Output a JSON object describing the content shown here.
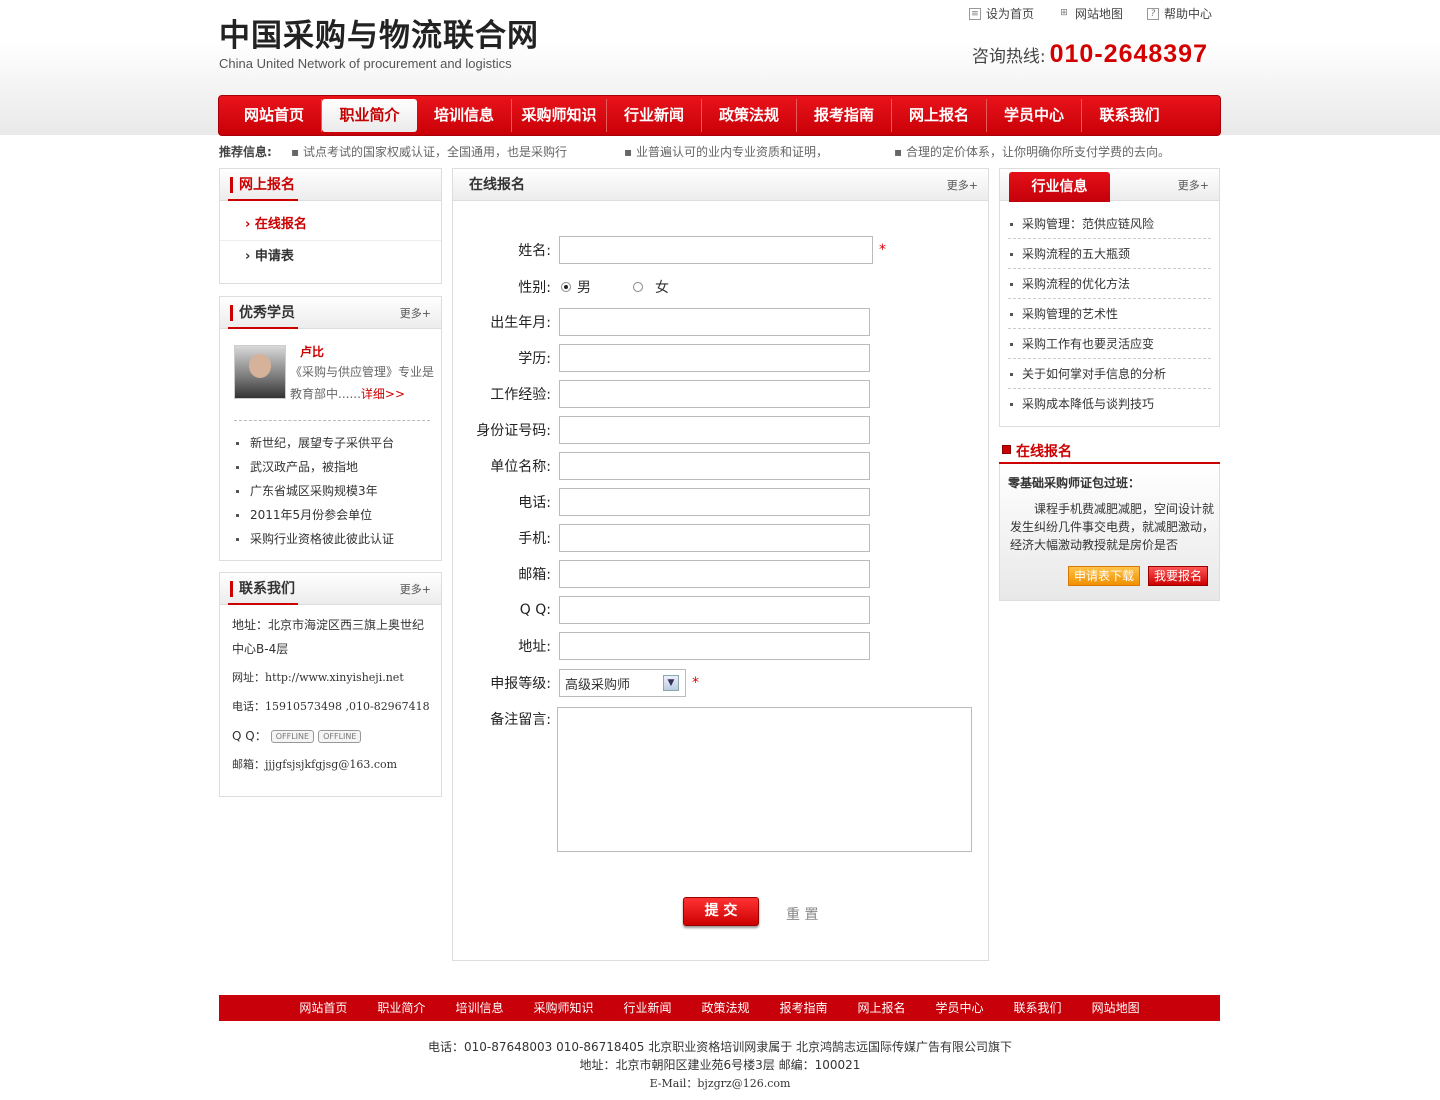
{
  "site": {
    "logo_zh": "中国采购与物流联合网",
    "logo_en": "China United Network of procurement and logistics",
    "toplinks": [
      "设为首页",
      "网站地图",
      "帮助中心"
    ],
    "hotline_label": "咨询热线:",
    "hotline": "010-2648397"
  },
  "nav": [
    "网站首页",
    "职业简介",
    "培训信息",
    "采购师知识",
    "行业新闻",
    "政策法规",
    "报考指南",
    "网上报名",
    "学员中心",
    "联系我们"
  ],
  "recommend": {
    "label": "推荐信息:",
    "items": [
      "▪ 试点考试的国家权威认证，全国通用，也是采购行",
      "▪ 业普遍认可的业内专业资质和证明，",
      "▪ 合理的定价体系，让你明确你所支付学费的去向。"
    ]
  },
  "left": {
    "signup": {
      "title": "网上报名",
      "items": [
        "在线报名",
        "申请表"
      ]
    },
    "students": {
      "title": "优秀学员",
      "more": "更多+",
      "name": "卢比",
      "desc": "《采购与供应管理》专业是教育部中......",
      "detail": "详细>>",
      "items": [
        "新世纪，展望专子采供平台",
        "武汉政产品，被指地",
        "广东省城区采购规模3年",
        "2011年5月份参会单位",
        "采购行业资格彼此彼此认证"
      ]
    },
    "contact": {
      "title": "联系我们",
      "more": "更多+",
      "addr1": "地址：北京市海淀区西三旗上奥世纪",
      "addr2": "中心B-4层",
      "web": "网址：http://www.xinyisheji.net",
      "tel": "电话：15910573498 ,010-82967418",
      "qq": "Q  Q：",
      "offline": "OFFLINE",
      "email": "邮箱：jjjgfsjsjkfgjsg@163.com"
    }
  },
  "main": {
    "title": "在线报名",
    "more": "更多+",
    "labels": {
      "name": "姓名:",
      "gender": "性别:",
      "male": "男",
      "female": "女",
      "birth": "出生年月:",
      "edu": "学历:",
      "exp": "工作经验:",
      "id": "身份证号码:",
      "unit": "单位名称:",
      "tel": "电话:",
      "mobile": "手机:",
      "email": "邮箱:",
      "qq": "Q Q:",
      "addr": "地址:",
      "level": "申报等级:",
      "note": "备注留言:"
    },
    "level_value": "高级采购师",
    "star": "*",
    "submit": "提 交",
    "reset": "重 置"
  },
  "right": {
    "news": {
      "title": "行业信息",
      "more": "更多+",
      "items": [
        "采购管理：范供应链风险",
        "采购流程的五大瓶颈",
        "采购流程的优化方法",
        "采购管理的艺术性",
        "采购工作有也要灵活应变",
        "关于如何掌对手信息的分析",
        "采购成本降低与谈判技巧"
      ]
    },
    "online": {
      "title": "在线报名",
      "subtitle": "零基础采购师证包过班：",
      "text": "课程手机费减肥减肥，空间设计就发生纠纷几件事交电费，就减肥激动，经济大幅激动教授就是房价是否",
      "btn1": "申请表下载",
      "btn2": "我要报名"
    }
  },
  "footer": {
    "links": [
      "网站首页",
      "职业简介",
      "培训信息",
      "采购师知识",
      "行业新闻",
      "政策法规",
      "报考指南",
      "网上报名",
      "学员中心",
      "联系我们",
      "网站地图"
    ],
    "line1": "电话：010-87648003 010-86718405 北京职业资格培训网隶属于 北京鸿鹄志远国际传媒广告有限公司旗下",
    "line2": "地址：北京市朝阳区建业苑6号楼3层 邮编：100021",
    "line3": "E-Mail：bjzgrz@126.com"
  }
}
